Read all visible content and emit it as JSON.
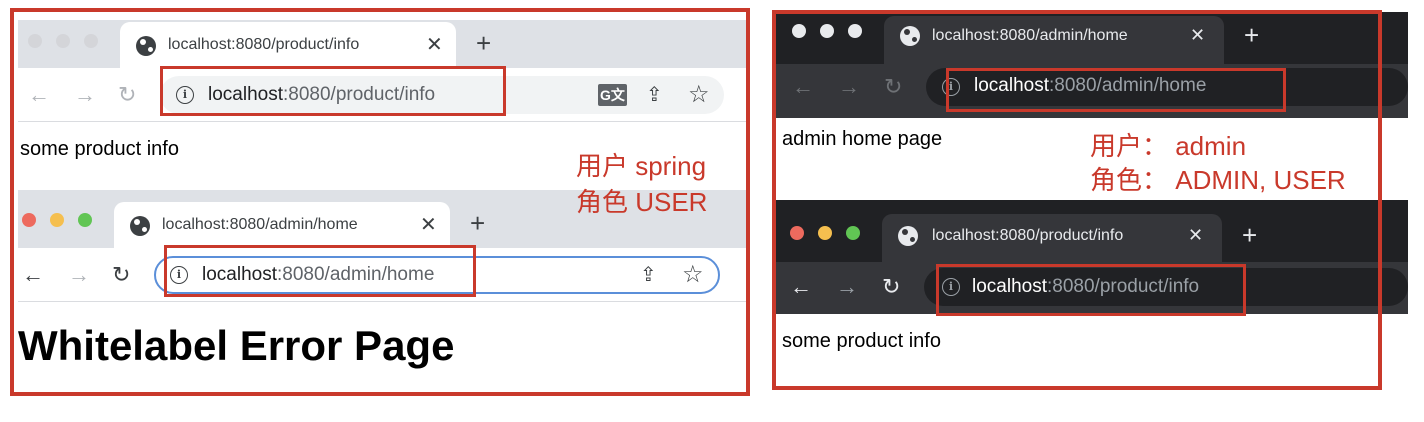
{
  "left_panel": {
    "window1": {
      "tab_title": "localhost:8080/product/info",
      "url_host": "localhost",
      "url_rest": ":8080/product/info",
      "body_text": "some product info",
      "close_glyph": "✕",
      "new_tab_glyph": "+"
    },
    "window2": {
      "tab_title": "localhost:8080/admin/home",
      "url_host": "localhost",
      "url_rest": ":8080/admin/home",
      "body_text": "Whitelabel Error Page",
      "close_glyph": "✕",
      "new_tab_glyph": "+"
    },
    "annotation_line1": "用户 spring",
    "annotation_line2": "角色 USER"
  },
  "right_panel": {
    "window1": {
      "tab_title": "localhost:8080/admin/home",
      "url_host": "localhost",
      "url_rest": ":8080/admin/home",
      "body_text": "admin home page",
      "close_glyph": "✕",
      "new_tab_glyph": "+"
    },
    "window2": {
      "tab_title": "localhost:8080/product/info",
      "url_host": "localhost",
      "url_rest": ":8080/product/info",
      "body_text": "some product info",
      "close_glyph": "✕",
      "new_tab_glyph": "+"
    },
    "annotation_line1": "用户： admin",
    "annotation_line2": "角色： ADMIN, USER"
  },
  "icons": {
    "back": "←",
    "forward": "→",
    "reload": "↻",
    "info": "i",
    "share": "⇪",
    "star": "☆",
    "translate": "G文"
  },
  "colors": {
    "annotation_red": "#c9392b",
    "light_tabstrip": "#dee1e6",
    "dark_tabstrip": "#202124",
    "dark_toolbar": "#35363a"
  }
}
